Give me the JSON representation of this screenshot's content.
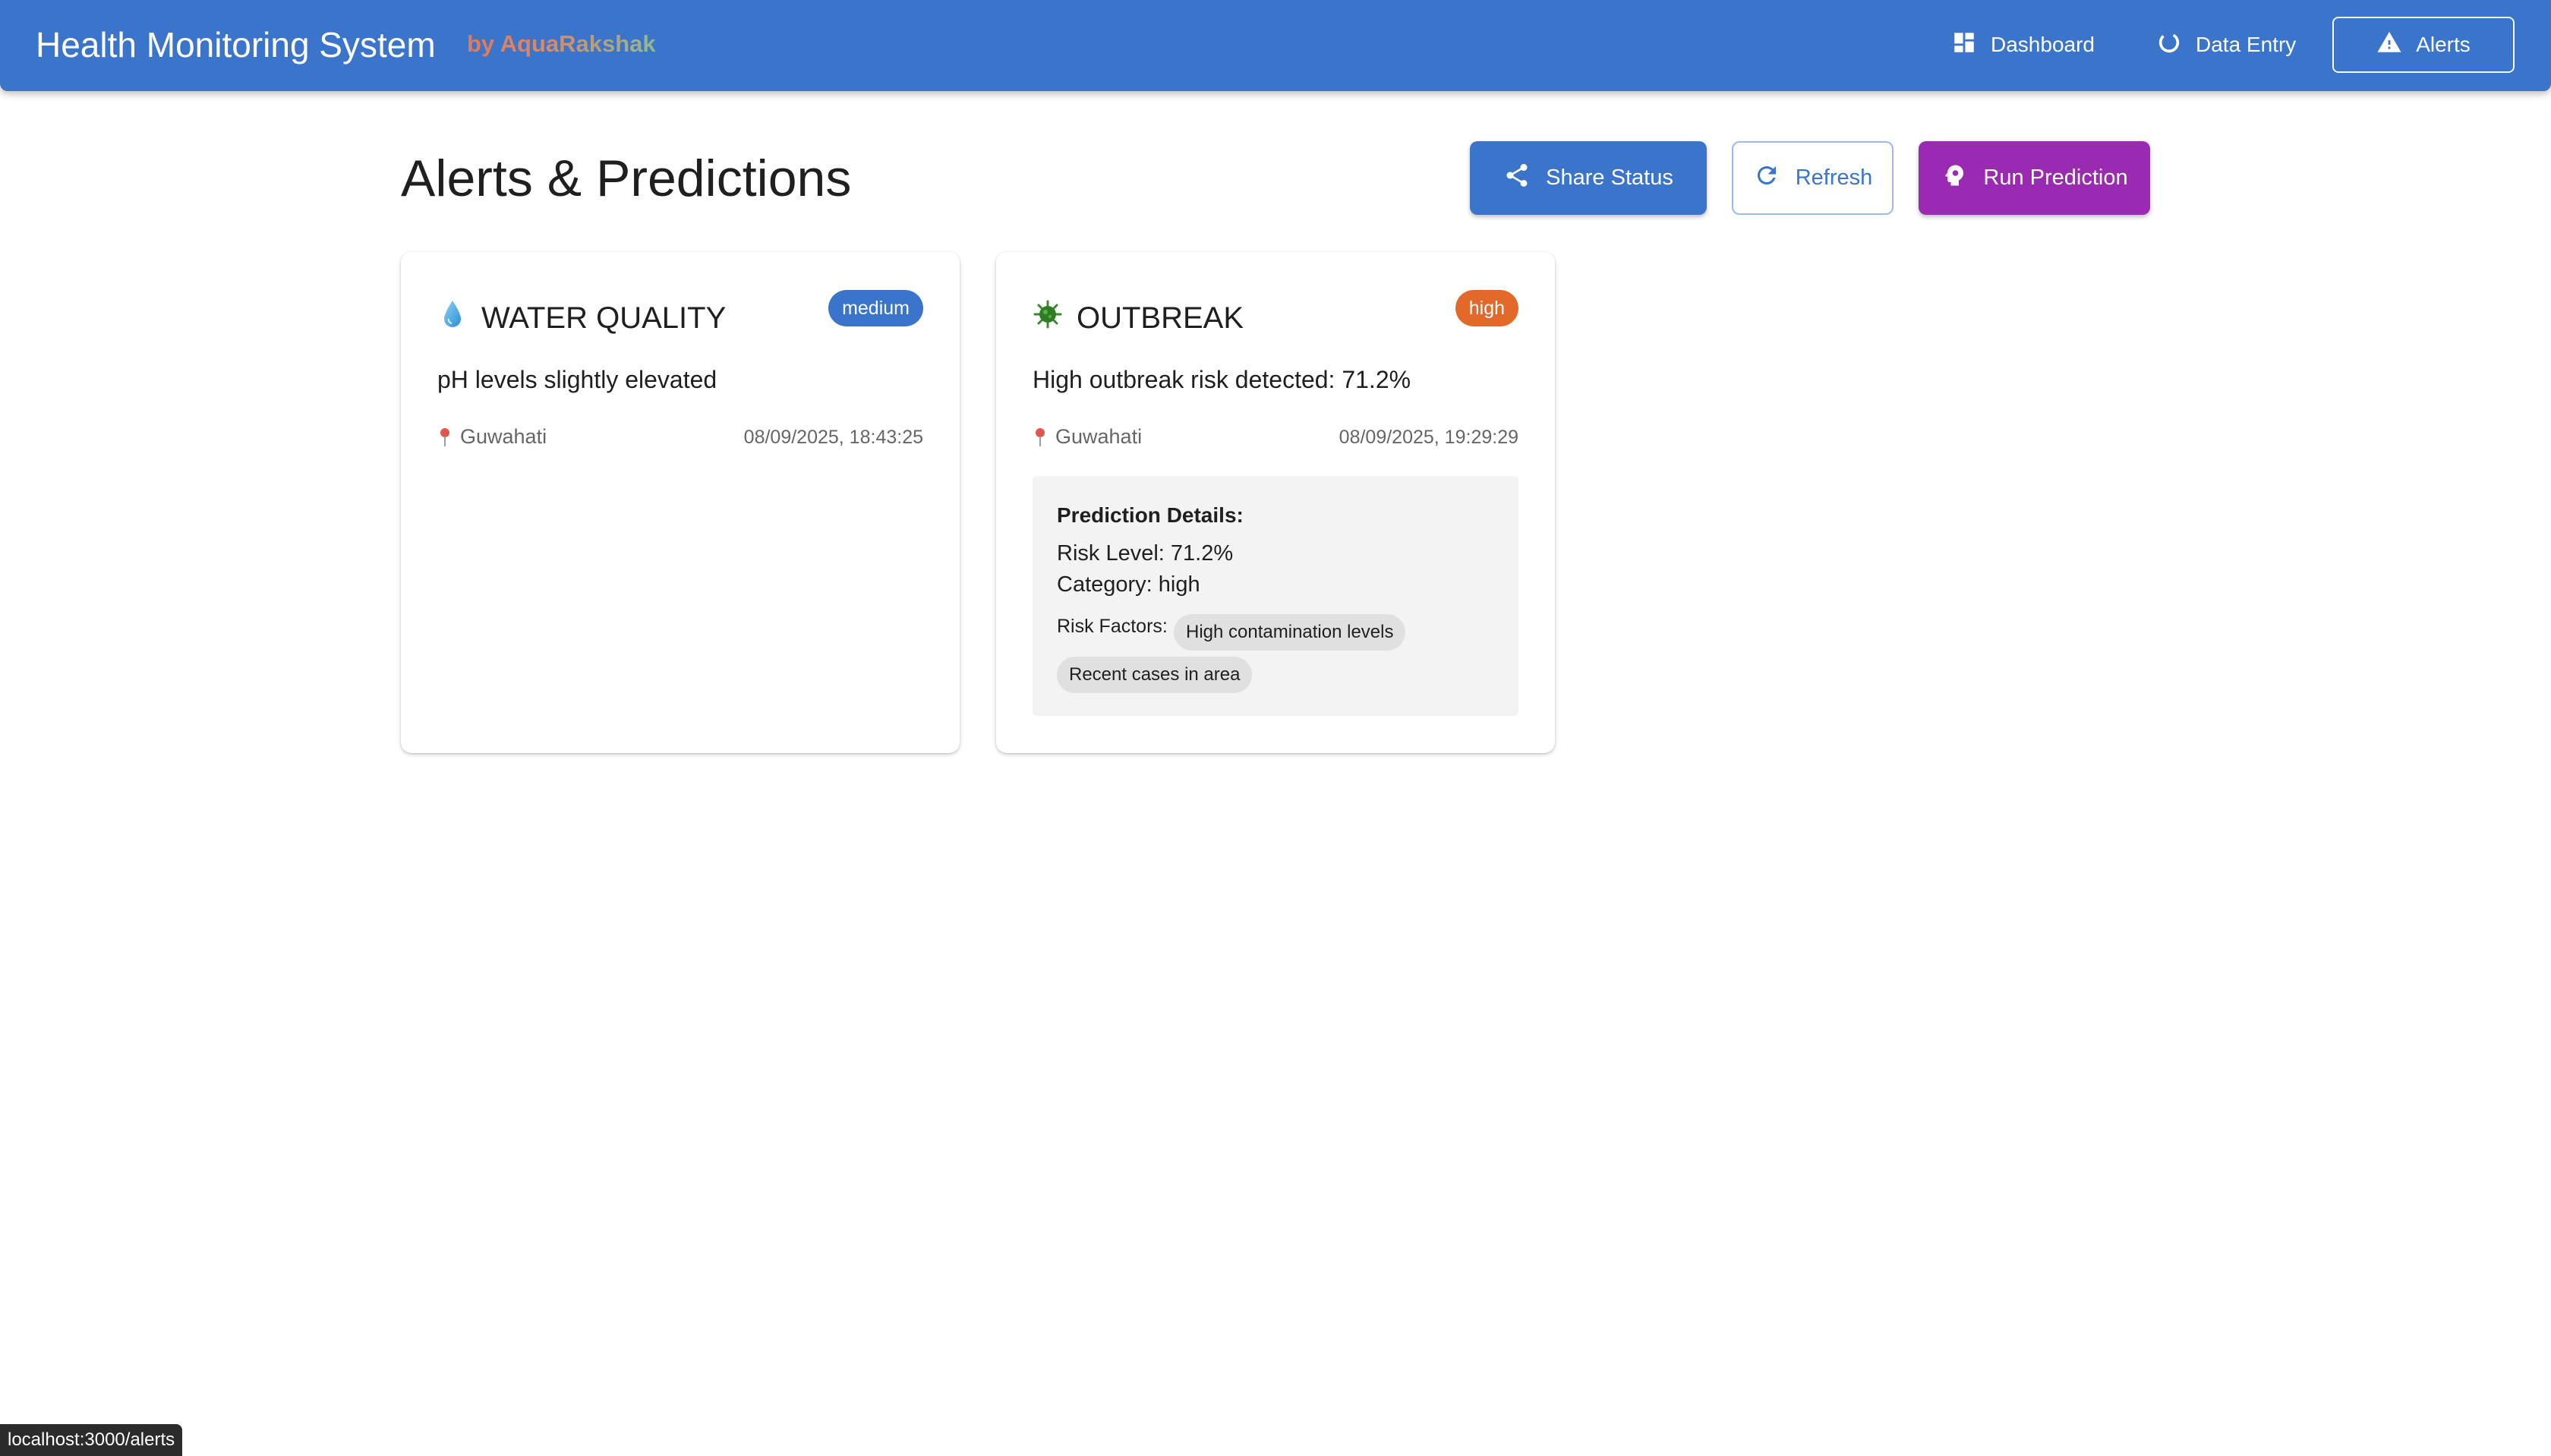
{
  "appbar": {
    "title": "Health Monitoring System",
    "subtitle": "by AquaRakshak",
    "nav": {
      "dashboard": "Dashboard",
      "data_entry": "Data Entry",
      "alerts": "Alerts"
    },
    "background_color": "#3a74cb"
  },
  "page": {
    "title": "Alerts & Predictions",
    "actions": {
      "share": "Share Status",
      "refresh": "Refresh",
      "run_prediction": "Run Prediction"
    }
  },
  "alerts": [
    {
      "icon": "droplet-icon",
      "type": "WATER QUALITY",
      "severity": "medium",
      "severity_color": "#3a74cb",
      "message": "pH levels slightly elevated",
      "location": "Guwahati",
      "timestamp": "08/09/2025, 18:43:25"
    },
    {
      "icon": "virus-icon",
      "type": "OUTBREAK",
      "severity": "high",
      "severity_color": "#e2692a",
      "message": "High outbreak risk detected: 71.2%",
      "location": "Guwahati",
      "timestamp": "08/09/2025, 19:29:29",
      "prediction": {
        "heading": "Prediction Details:",
        "risk_level": "Risk Level: 71.2%",
        "category": "Category: high",
        "factors_label": "Risk Factors:",
        "factors": [
          "High contamination levels",
          "Recent cases in area"
        ]
      }
    }
  ],
  "status_bar": {
    "url": "localhost:3000/alerts"
  }
}
